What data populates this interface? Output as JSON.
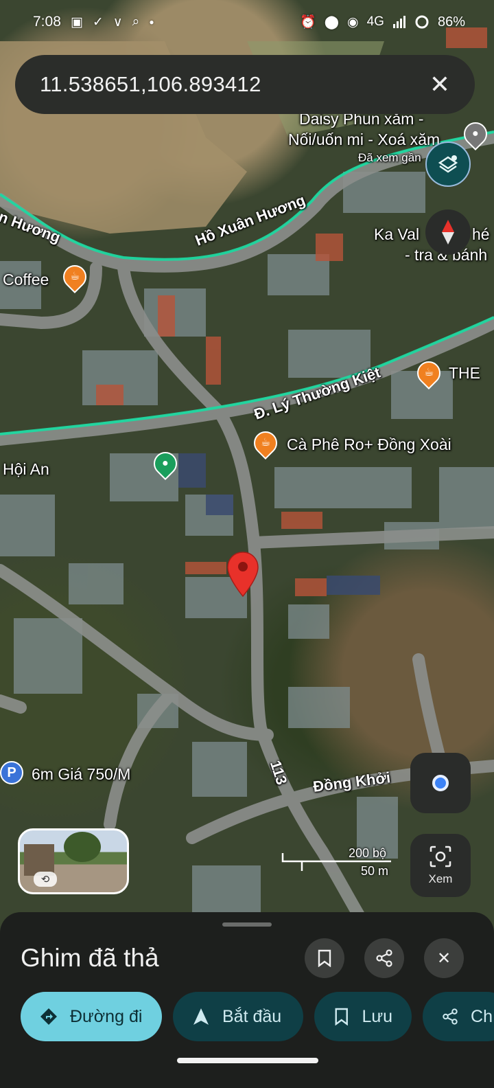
{
  "status_bar": {
    "time": "7:08",
    "network": "4G",
    "battery": "86%"
  },
  "search": {
    "query": "11.538651,106.893412"
  },
  "map": {
    "pois": [
      {
        "name": "Coffee",
        "icon": "coffee-icon"
      },
      {
        "name": "Daisy Phun xăm -",
        "icon": "place-icon"
      },
      {
        "name": "Nối/uốn mi - Xoá xăm",
        "icon": ""
      },
      {
        "name": "Đã xem gần",
        "icon": ""
      },
      {
        "name": "Ka Val",
        "icon": ""
      },
      {
        "name": "hé",
        "icon": ""
      },
      {
        "name": "- tra & bánh",
        "icon": ""
      },
      {
        "name": "THE",
        "icon": "coffee-icon"
      },
      {
        "name": "Cà Phê Ro+ Đồng Xoài",
        "icon": "coffee-icon"
      },
      {
        "name": "Hội An",
        "icon": ""
      },
      {
        "name": "6m Giá 750/M",
        "icon": "parking-icon"
      }
    ],
    "roads": {
      "ho_xuan_huong": "Hồ Xuân Hương",
      "huong_left": "n Hương",
      "ly_thuong_kiet": "Đ. Lý Thường Kiệt",
      "road_113": "113",
      "dong_khoi": "Đồng Khởi"
    },
    "scale": {
      "imperial": "200 bộ",
      "metric": "50 m"
    },
    "view_button_label": "Xem",
    "colors": {
      "route_line": "#1ed8a0",
      "pin_red": "#e8312a",
      "poi_orange": "#f08020",
      "poi_green": "#1a9e5c"
    }
  },
  "sheet": {
    "title": "Ghim đã thả",
    "actions": [
      {
        "label": "Đường đi",
        "icon": "directions-icon"
      },
      {
        "label": "Bắt đầu",
        "icon": "navigation-arrow-icon"
      },
      {
        "label": "Lưu",
        "icon": "bookmark-icon"
      },
      {
        "label": "Ch",
        "icon": "share-icon"
      }
    ]
  }
}
